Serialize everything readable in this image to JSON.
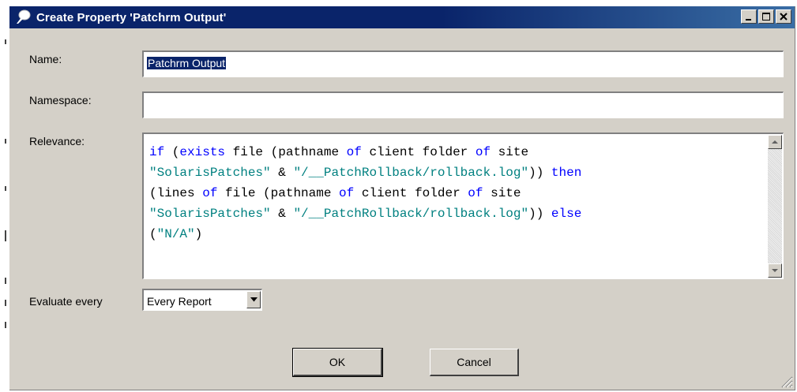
{
  "window": {
    "title": "Create Property 'Patchrm Output'"
  },
  "form": {
    "name_label": "Name:",
    "name_value": "Patchrm Output",
    "namespace_label": "Namespace:",
    "namespace_value": "",
    "relevance_label": "Relevance:",
    "evaluate_label": "Evaluate every",
    "evaluate_value": "Every Report"
  },
  "relevance_code": [
    [
      [
        "kw",
        "if"
      ],
      [
        "pl",
        " ("
      ],
      [
        "kw",
        "exists"
      ],
      [
        "pl",
        " file (pathname "
      ],
      [
        "kw",
        "of"
      ],
      [
        "pl",
        " client folder "
      ],
      [
        "kw",
        "of"
      ],
      [
        "pl",
        " site"
      ]
    ],
    [
      [
        "str",
        "\"SolarisPatches\""
      ],
      [
        "pl",
        " & "
      ],
      [
        "str",
        "\"/__PatchRollback/rollback.log\""
      ],
      [
        "pl",
        "))"
      ],
      [
        "pl",
        " "
      ],
      [
        "kw",
        "then"
      ]
    ],
    [
      [
        "pl",
        "(lines "
      ],
      [
        "kw",
        "of"
      ],
      [
        "pl",
        " file (pathname "
      ],
      [
        "kw",
        "of"
      ],
      [
        "pl",
        " client folder "
      ],
      [
        "kw",
        "of"
      ],
      [
        "pl",
        " site"
      ]
    ],
    [
      [
        "str",
        "\"SolarisPatches\""
      ],
      [
        "pl",
        " & "
      ],
      [
        "str",
        "\"/__PatchRollback/rollback.log\""
      ],
      [
        "pl",
        "))"
      ],
      [
        "pl",
        " "
      ],
      [
        "kw",
        "else"
      ]
    ],
    [
      [
        "pl",
        "("
      ],
      [
        "str",
        "\"N/A\""
      ],
      [
        "pl",
        ")"
      ]
    ]
  ],
  "buttons": {
    "ok": "OK",
    "cancel": "Cancel"
  },
  "icons": {
    "app": "pin-icon",
    "minimize": "minimize-icon",
    "maximize": "maximize-icon",
    "close": "close-icon"
  },
  "colors": {
    "titlebar": "#0a246a",
    "keyword": "#0000ff",
    "string": "#008080",
    "selection": "#0a246a"
  }
}
